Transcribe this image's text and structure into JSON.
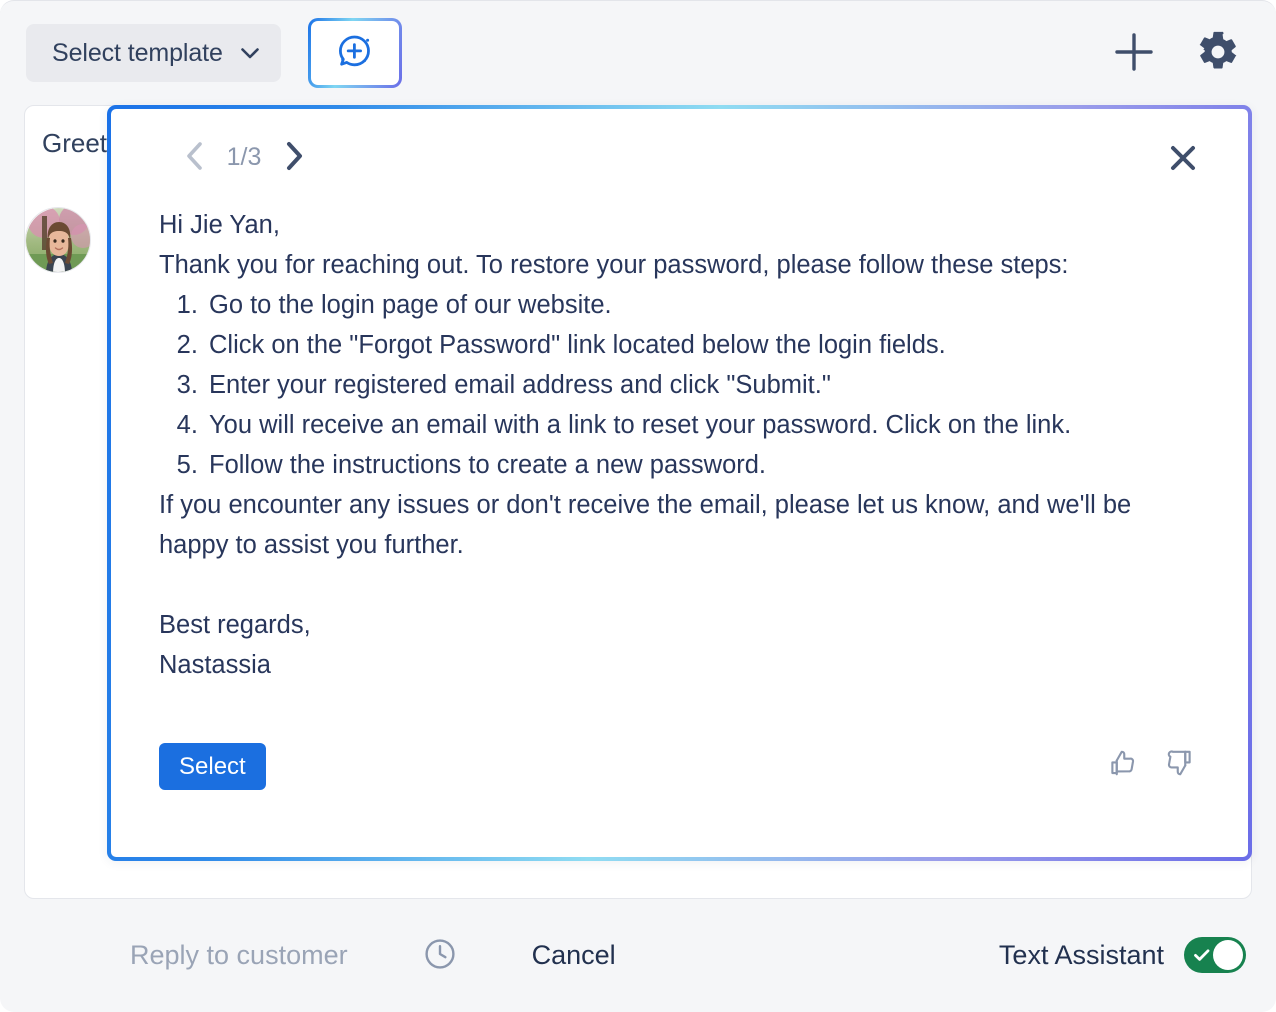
{
  "toolbar": {
    "template_select_label": "Select template",
    "template_select_icon": "chevron-down-icon",
    "ai_assistant_icon": "ai-chat-sparkle-icon",
    "add_icon": "plus-icon",
    "settings_icon": "gear-icon"
  },
  "reply_card": {
    "greeting_text": "Greeting",
    "avatar_name": "agent-avatar"
  },
  "modal": {
    "prev_icon": "chevron-left-icon",
    "next_icon": "chevron-right-icon",
    "page_indicator": "1/3",
    "close_icon": "close-icon",
    "suggestion": {
      "salutation": "Hi Jie Yan,",
      "intro": "Thank you for reaching out. To restore your password, please follow these steps:",
      "steps": [
        "Go to the login page of our website.",
        "Click on the \"Forgot Password\" link located below the login fields.",
        "Enter your registered email address and click \"Submit.\"",
        "You will receive an email with a link to reset your password. Click on the link.",
        "Follow the instructions to create a new password."
      ],
      "closing": "If you encounter any issues or don't receive the email, please let us know, and we'll be happy to assist you further.",
      "signoff": "Best regards,",
      "signature": "Nastassia"
    },
    "select_label": "Select",
    "thumbs_up_icon": "thumbs-up-icon",
    "thumbs_down_icon": "thumbs-down-icon"
  },
  "bottom_bar": {
    "reply_label": "Reply to customer",
    "schedule_icon": "clock-icon",
    "cancel_label": "Cancel",
    "assistant_label": "Text Assistant",
    "assistant_toggle_state": "on",
    "assistant_toggle_icon": "check-icon"
  },
  "colors": {
    "accent_blue": "#1b6fe0",
    "gradient_start": "#1b72e8",
    "gradient_mid": "#8fdcf2",
    "gradient_end": "#6b6de8",
    "toggle_on_green": "#17824f",
    "text_dark": "#28365b",
    "text_muted": "#9aa4b6",
    "page_bg": "#f5f6f8"
  }
}
